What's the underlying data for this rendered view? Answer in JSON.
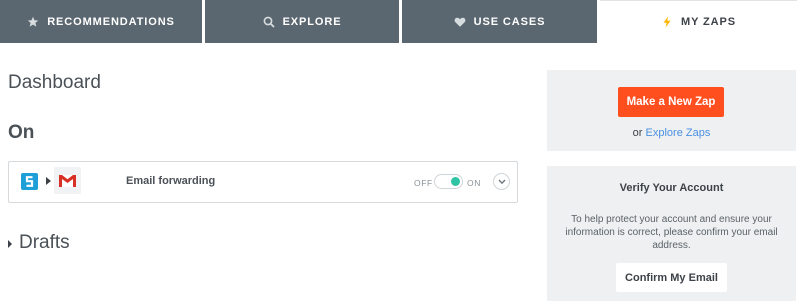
{
  "tabs": [
    {
      "label": "RECOMMENDATIONS",
      "icon": "star-icon",
      "active": false
    },
    {
      "label": "EXPLORE",
      "icon": "search-icon",
      "active": false
    },
    {
      "label": "USE CASES",
      "icon": "heart-icon",
      "active": false
    },
    {
      "label": "MY ZAPS",
      "icon": "lightning-icon",
      "active": true
    }
  ],
  "main": {
    "title": "Dashboard",
    "section_on": "On",
    "zap": {
      "name": "Email forwarding",
      "apps": [
        "app-icon",
        "gmail-icon"
      ],
      "toggle_off_label": "OFF",
      "toggle_on_label": "ON",
      "enabled": true
    },
    "section_drafts": "Drafts"
  },
  "sidebar": {
    "new_zap_label": "Make a New Zap",
    "or_text": "or",
    "explore_link": "Explore Zaps",
    "verify_title": "Verify Your Account",
    "verify_text": "To help protect your account and ensure your information is correct, please confirm your email address.",
    "confirm_label": "Confirm My Email"
  },
  "colors": {
    "tab_bg": "#5b6770",
    "accent_orange": "#ff4f1f",
    "toggle_on": "#2ec4a4",
    "link_blue": "#4a90e2",
    "card_bg": "#eef0f1"
  }
}
